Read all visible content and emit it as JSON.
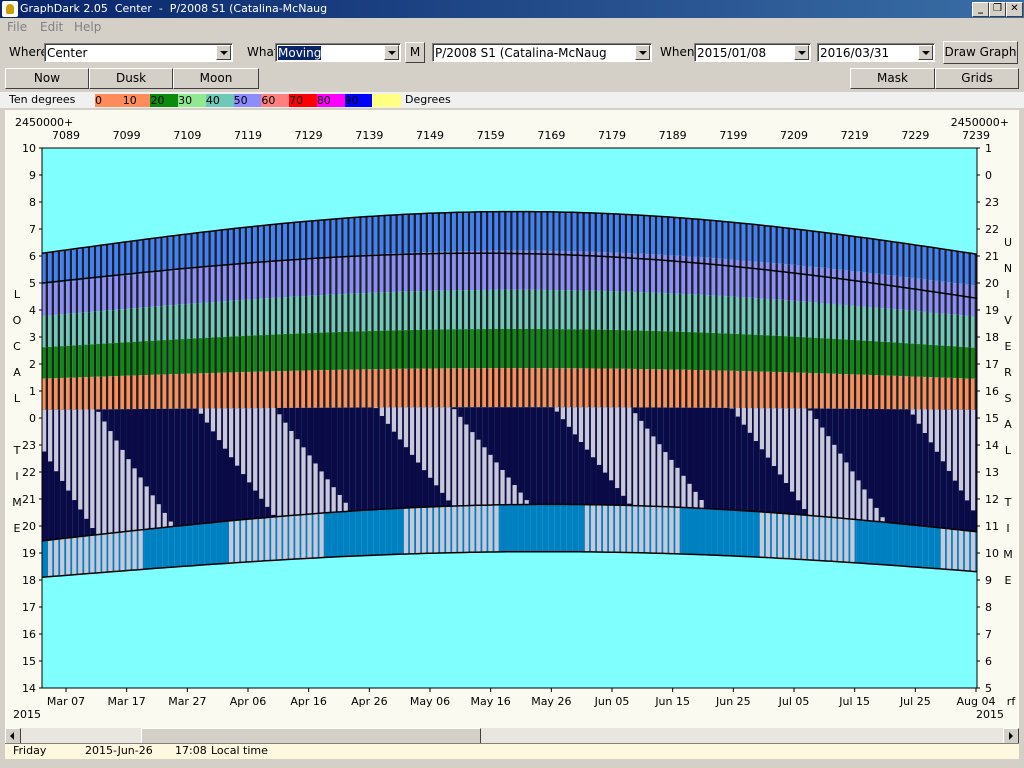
{
  "window": {
    "title": "GraphDark 2.05  Center  -  P/2008 S1 (Catalina-McNaug",
    "controls": [
      "_",
      "❐",
      "✕"
    ]
  },
  "menu": [
    "File",
    "Edit",
    "Help"
  ],
  "toolbar": {
    "where_label": "Where",
    "where_value": "Center",
    "what_label": "What",
    "what_value": "Moving",
    "m_button": "M",
    "object_value": "P/2008 S1 (Catalina-McNaug",
    "when_label": "When",
    "date_from": "2015/01/08",
    "date_to": "2016/03/31",
    "draw_button": "Draw Graph"
  },
  "buttons": {
    "now": "Now",
    "dusk": "Dusk",
    "moon": "Moon",
    "mask": "Mask",
    "grids": "Grids"
  },
  "legend": {
    "label": "Ten degrees",
    "unit": "Degrees",
    "bands": [
      {
        "value": "0",
        "color": "#ff8c5a"
      },
      {
        "value": "10",
        "color": "#ff8c5a"
      },
      {
        "value": "20",
        "color": "#0c8c0c"
      },
      {
        "value": "30",
        "color": "#90e890"
      },
      {
        "value": "40",
        "color": "#70c8b8"
      },
      {
        "value": "50",
        "color": "#8c8cff"
      },
      {
        "value": "60",
        "color": "#ff8080"
      },
      {
        "value": "70",
        "color": "#ff0000"
      },
      {
        "value": "80",
        "color": "#ff00ff"
      },
      {
        "value": "90",
        "color": "#0000ff"
      },
      {
        "value": "",
        "color": "#ffff80"
      }
    ]
  },
  "chart_data": {
    "type": "area",
    "jd_prefix_left": "2450000+",
    "jd_prefix_right": "2450000+",
    "top_ticks": [
      "7089",
      "7099",
      "7109",
      "7119",
      "7129",
      "7139",
      "7149",
      "7159",
      "7169",
      "7179",
      "7189",
      "7199",
      "7209",
      "7219",
      "7229",
      "7239"
    ],
    "bottom_ticks": [
      "Mar 07",
      "Mar 17",
      "Mar 27",
      "Apr 06",
      "Apr 16",
      "Apr 26",
      "May 06",
      "May 16",
      "May 26",
      "Jun 05",
      "Jun 15",
      "Jun 25",
      "Jul 05",
      "Jul 15",
      "Jul 25",
      "Aug 04"
    ],
    "left_ticks": [
      "10",
      "9",
      "8",
      "7",
      "6",
      "5",
      "4",
      "3",
      "2",
      "1",
      "0",
      "23",
      "22",
      "21",
      "20",
      "19",
      "18",
      "17",
      "16",
      "15",
      "14"
    ],
    "right_ticks": [
      "1",
      "0",
      "23",
      "22",
      "21",
      "20",
      "19",
      "18",
      "17",
      "16",
      "15",
      "14",
      "13",
      "12",
      "11",
      "10",
      "9",
      "8",
      "7",
      "6",
      "5"
    ],
    "left_axis_title": [
      "L",
      "O",
      "C",
      "A",
      "L",
      "",
      "T",
      "I",
      "M",
      "E"
    ],
    "right_axis_title": [
      "U",
      "N",
      "I",
      "V",
      "E",
      "R",
      "S",
      "A",
      "L",
      "",
      "T",
      "I",
      "M",
      "E"
    ],
    "year_left": "2015",
    "year_right": "2015",
    "corner_label": "rf",
    "colors": {
      "background": "#80ffff",
      "twilight": "#0080c0",
      "night": "#0a0a46",
      "moon": "#c8c8d8",
      "alt0": "#ff8c5a",
      "alt10": "#0c8c0c",
      "alt20": "#90e890",
      "alt30": "#70c8b8",
      "alt40": "#8c8cff",
      "alt50": "#4080ff"
    }
  },
  "status": {
    "day": "Friday",
    "date": "2015-Jun-26",
    "time": "17:08",
    "zone": "Local time"
  }
}
